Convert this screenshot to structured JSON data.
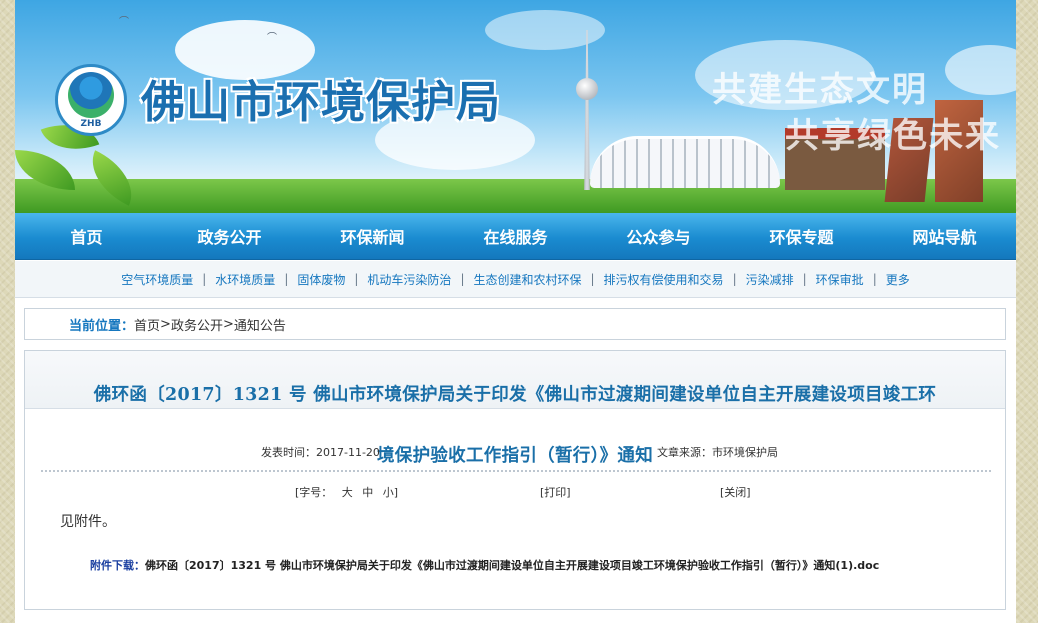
{
  "banner": {
    "logo_text": "ZHB",
    "site_title": "佛山市环境保护局",
    "slogan_line1": "共建生态文明",
    "slogan_line2": "共享绿色未来"
  },
  "main_nav": {
    "items": [
      {
        "label": "首页"
      },
      {
        "label": "政务公开"
      },
      {
        "label": "环保新闻"
      },
      {
        "label": "在线服务"
      },
      {
        "label": "公众参与"
      },
      {
        "label": "环保专题"
      },
      {
        "label": "网站导航"
      }
    ]
  },
  "sub_nav": {
    "separator": "|",
    "items": [
      {
        "label": "空气环境质量"
      },
      {
        "label": "水环境质量"
      },
      {
        "label": "固体废物"
      },
      {
        "label": "机动车污染防治"
      },
      {
        "label": "生态创建和农村环保"
      },
      {
        "label": "排污权有偿使用和交易"
      },
      {
        "label": "污染减排"
      },
      {
        "label": "环保审批"
      },
      {
        "label": "更多"
      }
    ]
  },
  "breadcrumb": {
    "label": "当前位置：",
    "items": [
      "首页",
      "政务公开",
      "通知公告"
    ],
    "separator": ">"
  },
  "article": {
    "title_line1": "佛环函〔2017〕1321 号 佛山市环境保护局关于印发《佛山市过渡期间建设单位自主开展建设项目竣工环",
    "title_line2": "境保护验收工作指引（暂行）》通知",
    "publish_label": "发表时间：",
    "publish_date": "2017-11-20",
    "source_label": "文章来源：",
    "source": "市环境保护局",
    "font_size_label": "[字号：",
    "font_big": "大",
    "font_mid": "中",
    "font_small": "小]",
    "print_label": "[打印]",
    "close_label": "[关闭]",
    "body": "见附件。",
    "attachment_label": "附件下载：",
    "attachment_name": "佛环函〔2017〕1321 号 佛山市环境保护局关于印发《佛山市过渡期间建设单位自主开展建设项目竣工环境保护验收工作指引（暂行）》通知(1).doc"
  }
}
